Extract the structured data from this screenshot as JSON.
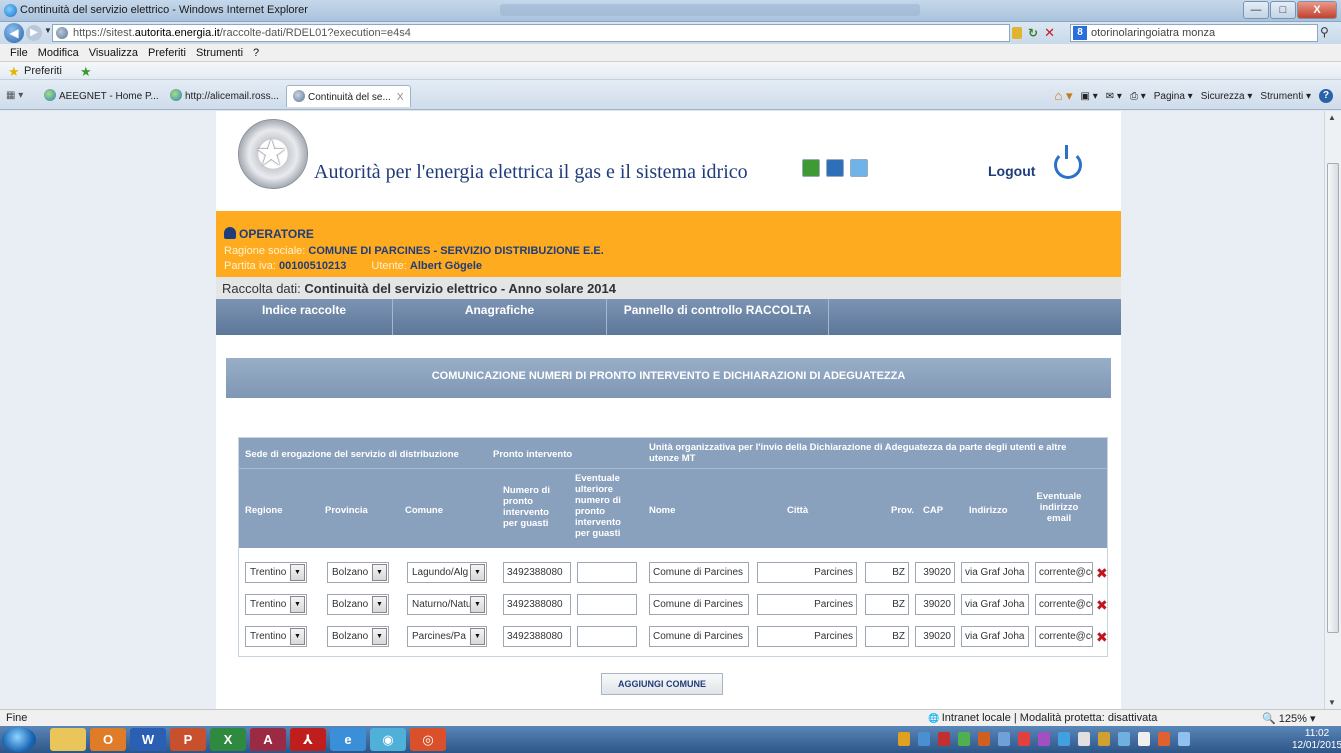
{
  "window": {
    "title": "Continuità del servizio elettrico - Windows Internet Explorer",
    "buttons": {
      "minimize": "—",
      "maximize": "□",
      "close": "X"
    }
  },
  "address_bar": {
    "url_prefix": "https://sitest.",
    "url_domain": "autorita.energia.it",
    "url_path": "/raccolte-dati/RDEL01?execution=e4s4",
    "search_text": "otorinolaringoiatra monza"
  },
  "menu": [
    "File",
    "Modifica",
    "Visualizza",
    "Preferiti",
    "Strumenti",
    "?"
  ],
  "favorites": {
    "label": "Preferiti"
  },
  "tabs": [
    {
      "label": "AEEGNET - Home P..."
    },
    {
      "label": "http://alicemail.ross..."
    },
    {
      "label": "Continuità del se...",
      "active": true
    }
  ],
  "command_bar": [
    "Pagina ▾",
    "Sicurezza ▾",
    "Strumenti ▾"
  ],
  "site": {
    "title": "Autorità per l'energia elettrica il gas e il sistema idrico",
    "logout": "Logout"
  },
  "operatore": {
    "heading": "OPERATORE",
    "ragione_label": "Ragione sociale:",
    "ragione_value": "COMUNE DI PARCINES - SERVIZIO DISTRIBUZIONE E.E.",
    "piva_label": "Partita iva:",
    "piva_value": "00100510213",
    "utente_label": "Utente:",
    "utente_value": "Albert Gögele"
  },
  "raccolta": {
    "label": "Raccolta dati:",
    "value": "Continuità del servizio elettrico - Anno solare 2014"
  },
  "nav": [
    "Indice raccolte",
    "Anagrafiche",
    "Pannello di controllo RACCOLTA"
  ],
  "section_title": "COMUNICAZIONE NUMERI DI PRONTO INTERVENTO E DICHIARAZIONI DI ADEGUATEZZA",
  "table": {
    "group_headers": {
      "sede": "Sede di erogazione del servizio di distribuzione",
      "pronto": "Pronto intervento",
      "unita": "Unità organizzativa per l'invio della Dichiarazione di Adeguatezza da parte degli utenti e altre utenze MT"
    },
    "columns": {
      "regione": "Regione",
      "provincia": "Provincia",
      "comune": "Comune",
      "numero": "Numero di pronto intervento per guasti",
      "ulteriore": "Eventuale ulteriore numero di pronto intervento per guasti",
      "nome": "Nome",
      "citta": "Città",
      "prov": "Prov.",
      "cap": "CAP",
      "indirizzo": "Indirizzo",
      "email": "Eventuale indirizzo email"
    },
    "rows": [
      {
        "regione": "Trentino",
        "provincia": "Bolzano",
        "comune": "Lagundo/Alg",
        "numero": "3492388080",
        "ulteriore": "",
        "nome": "Comune di Parcines",
        "citta": "Parcines",
        "prov": "BZ",
        "cap": "39020",
        "indirizzo": "via Graf Joha",
        "email": "corrente@co"
      },
      {
        "regione": "Trentino",
        "provincia": "Bolzano",
        "comune": "Naturno/Natu",
        "numero": "3492388080",
        "ulteriore": "",
        "nome": "Comune di Parcines",
        "citta": "Parcines",
        "prov": "BZ",
        "cap": "39020",
        "indirizzo": "via Graf Joha",
        "email": "corrente@co"
      },
      {
        "regione": "Trentino",
        "provincia": "Bolzano",
        "comune": "Parcines/Pa",
        "numero": "3492388080",
        "ulteriore": "",
        "nome": "Comune di Parcines",
        "citta": "Parcines",
        "prov": "BZ",
        "cap": "39020",
        "indirizzo": "via Graf Joha",
        "email": "corrente@co"
      }
    ]
  },
  "add_button": "AGGIUNGI COMUNE",
  "status": {
    "left": "Fine",
    "zone": "Intranet locale | Modalità protetta: disattivata",
    "zoom": "125%"
  },
  "clock": {
    "time": "11:02",
    "date": "12/01/2015"
  }
}
